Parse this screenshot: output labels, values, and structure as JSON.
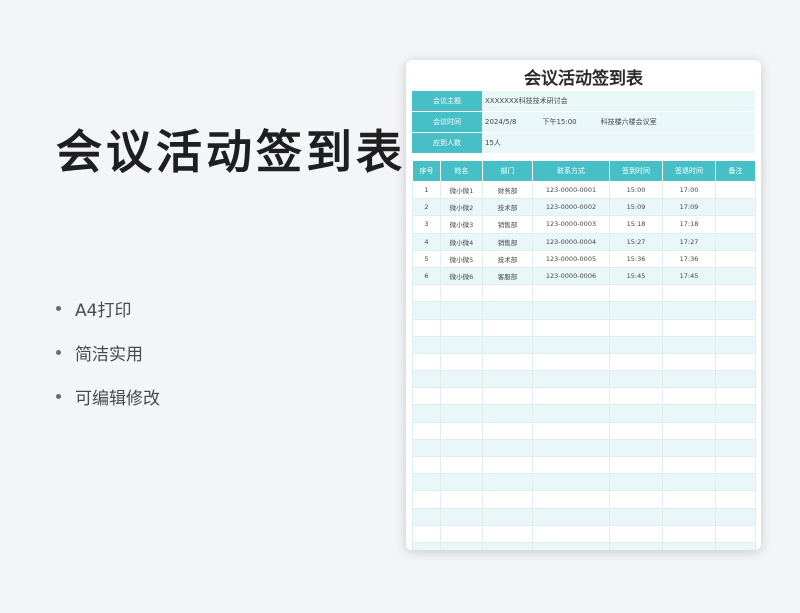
{
  "promo": {
    "title": "会议活动签到表",
    "features": [
      "A4打印",
      "简洁实用",
      "可编辑修改"
    ]
  },
  "sheet": {
    "title": "会议活动签到表",
    "info": {
      "topic_label": "会议主题",
      "topic_value": "XXXXXXX科技技术研讨会",
      "time_label": "会议时间",
      "date": "2024/5/8",
      "time": "下午15:00",
      "location": "科技楼六楼会议室",
      "count_label": "应到人数",
      "count_value": "15人"
    },
    "columns": [
      "序号",
      "姓名",
      "部门",
      "联系方式",
      "签到时间",
      "签退时间",
      "备注"
    ],
    "rows": [
      [
        "1",
        "微小微1",
        "财务部",
        "123-0000-0001",
        "15:00",
        "17:00",
        ""
      ],
      [
        "2",
        "微小微2",
        "技术部",
        "123-0000-0002",
        "15:09",
        "17:09",
        ""
      ],
      [
        "3",
        "微小微3",
        "销售部",
        "123-0000-0003",
        "15:18",
        "17:18",
        ""
      ],
      [
        "4",
        "微小微4",
        "销售部",
        "123-0000-0004",
        "15:27",
        "17:27",
        ""
      ],
      [
        "5",
        "微小微5",
        "技术部",
        "123-0000-0005",
        "15:36",
        "17:36",
        ""
      ],
      [
        "6",
        "微小微6",
        "客服部",
        "123-0000-0006",
        "15:45",
        "17:45",
        ""
      ]
    ]
  },
  "colors": {
    "header_bg": "#46bfc6",
    "stripe_bg": "#e9f7f8"
  }
}
